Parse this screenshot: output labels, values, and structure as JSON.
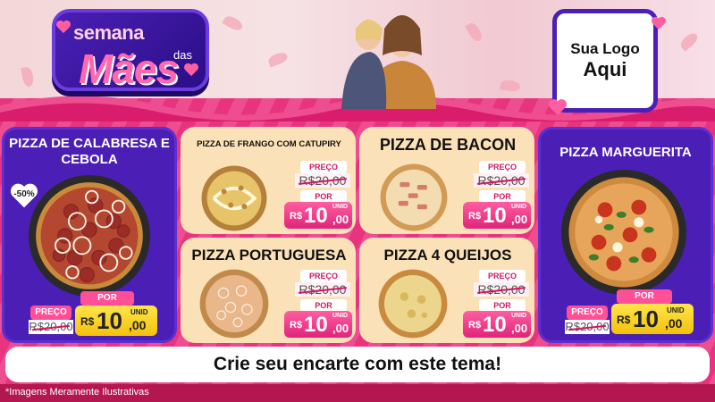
{
  "header": {
    "title_line1": "semana",
    "title_small": "das",
    "title_line2": "Mães",
    "logo_line1": "Sua Logo",
    "logo_line2": "Aqui"
  },
  "products": [
    {
      "name": "PIZZA DE CALABRESA E CEBOLA",
      "preco_label": "PREÇO",
      "old_price": "R$20,00",
      "por_label": "POR",
      "currency": "R$",
      "price_int": "10",
      "price_cents": ",00",
      "unit": "UNID",
      "discount": "-50%"
    },
    {
      "name": "PIZZA DE FRANGO COM CATUPIRY",
      "preco_label": "PREÇO",
      "old_price": "R$20,00",
      "por_label": "POR",
      "currency": "R$",
      "price_int": "10",
      "price_cents": ",00",
      "unit": "UNID"
    },
    {
      "name": "PIZZA DE BACON",
      "preco_label": "PREÇO",
      "old_price": "R$20,00",
      "por_label": "POR",
      "currency": "R$",
      "price_int": "10",
      "price_cents": ",00",
      "unit": "UNID"
    },
    {
      "name": "PIZZA MARGUERITA",
      "preco_label": "PREÇO",
      "old_price": "R$20,00",
      "por_label": "POR",
      "currency": "R$",
      "price_int": "10",
      "price_cents": ",00",
      "unit": "UNID"
    },
    {
      "name": "PIZZA PORTUGUESA",
      "preco_label": "PREÇO",
      "old_price": "R$20,00",
      "por_label": "POR",
      "currency": "R$",
      "price_int": "10",
      "price_cents": ",00",
      "unit": "UNID"
    },
    {
      "name": "PIZZA 4 QUEIJOS",
      "preco_label": "PREÇO",
      "old_price": "R$20,00",
      "por_label": "POR",
      "currency": "R$",
      "price_int": "10",
      "price_cents": ",00",
      "unit": "UNID"
    }
  ],
  "cta_text": "Crie seu encarte com este tema!",
  "footer_text": "*Imagens Meramente Ilustrativas",
  "colors": {
    "purple": "#4b1fb5",
    "pink": "#e8347f",
    "cream": "#fbe1b8",
    "yellow": "#f3c10c"
  }
}
